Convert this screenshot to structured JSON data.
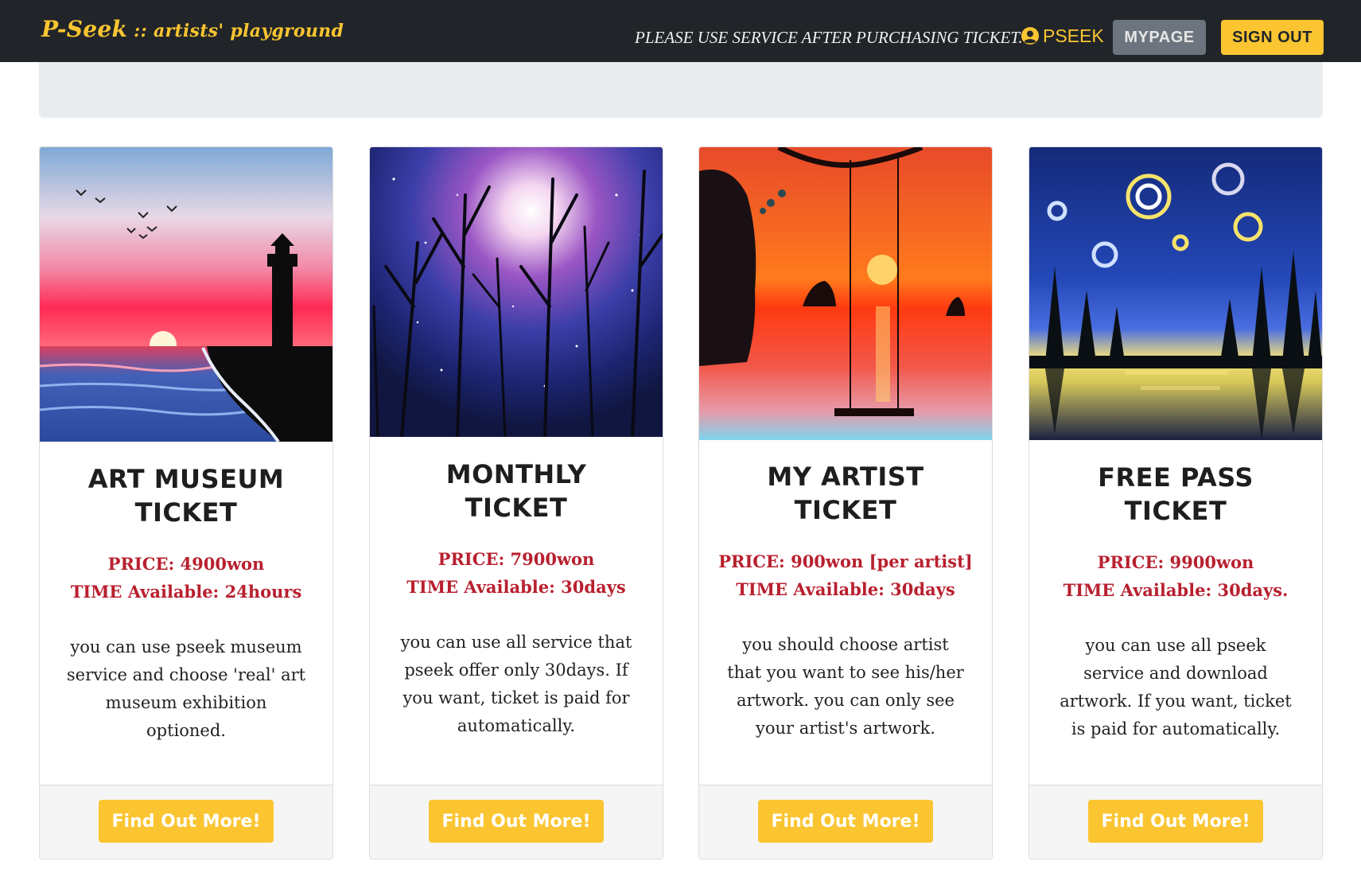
{
  "navbar": {
    "brand_main": "P-Seek",
    "brand_sub": " :: artists' playground",
    "notice": "PLEASE USE SERVICE AFTER PURCHASING TICKET.",
    "username": "PSEEK",
    "user_icon": "user-circle-icon",
    "mypage_label": "MYPAGE",
    "signout_label": "SIGN OUT"
  },
  "colors": {
    "navbar_bg": "#212529",
    "accent": "#fbc531",
    "price_red": "#b8202f",
    "mypage_bg": "#6c757d"
  },
  "cards": [
    {
      "image": "lighthouse-sunset-painting",
      "title_line1": "ART MUSEUM",
      "title_line2": "TICKET",
      "price": "PRICE: 4900won",
      "time": "TIME Available: 24hours",
      "desc_lines": [
        "you can use pseek museum",
        "service and choose 'real' art",
        "museum exhibition",
        "optioned."
      ],
      "button": "Find Out More!"
    },
    {
      "image": "moonlit-forest-painting",
      "title_line1": "MONTHLY",
      "title_line2": "TICKET",
      "price": "PRICE: 7900won",
      "time": "TIME Available: 30days",
      "desc_lines": [
        "you can use all service that",
        "pseek offer only 30days. If",
        "you want, ticket is paid for",
        "automatically."
      ],
      "button": "Find Out More!"
    },
    {
      "image": "swing-sunset-painting",
      "title_line1": "MY ARTIST",
      "title_line2": "TICKET",
      "price": "PRICE: 900won [per artist]",
      "time": "TIME Available: 30days",
      "desc_lines": [
        "you should choose artist",
        "that you want to see his/her",
        "artwork. you can only see",
        "your artist's artwork."
      ],
      "button": "Find Out More!"
    },
    {
      "image": "starry-night-lake-painting",
      "title_line1": "FREE PASS",
      "title_line2": "TICKET",
      "price": "PRICE: 9900won",
      "time": "TIME Available: 30days.",
      "desc_lines": [
        "you can use all pseek",
        "service and download",
        "artwork. If you want, ticket",
        "is paid for automatically."
      ],
      "button": "Find Out More!"
    }
  ]
}
